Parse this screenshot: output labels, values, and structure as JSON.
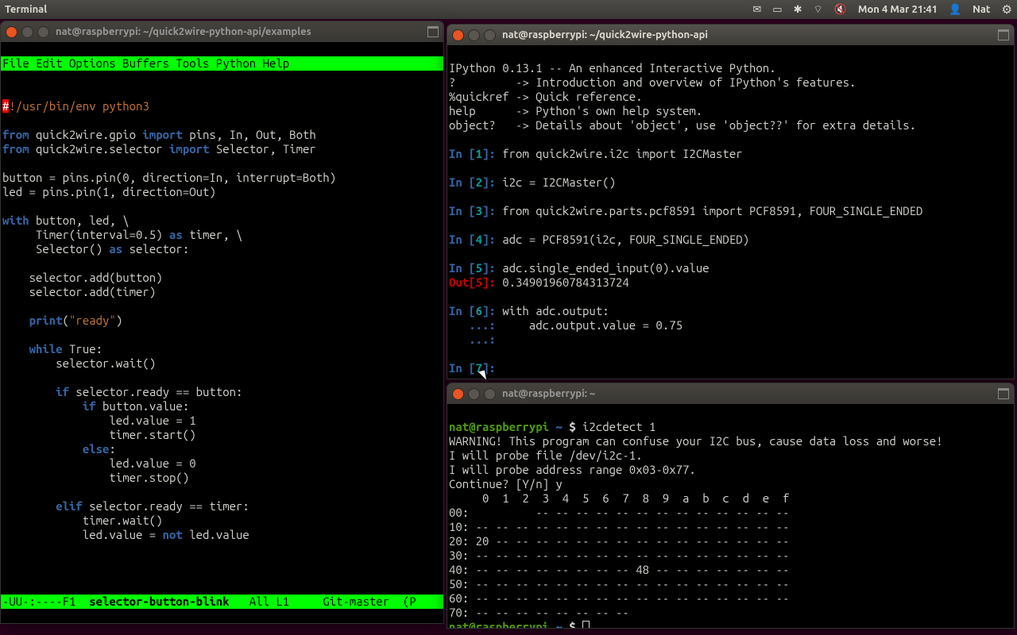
{
  "panel": {
    "app": "Terminal",
    "clock": "Mon  4 Mar 21:41",
    "user": "Nat",
    "mail_icon": "✉",
    "battery_icon": "▭",
    "bt_icon": "✱",
    "wifi_icon": "⌔",
    "sound_icon": "🔇",
    "user_icon": "👤",
    "gear_icon": "⚙"
  },
  "emacs": {
    "title": "nat@raspberrypi: ~/quick2wire-python-api/examples",
    "menus": "File Edit Options Buffers Tools Python Help",
    "shebang_hash": "#",
    "shebang_rest": "!/usr/bin/env python3",
    "code": {
      "l1a": "from",
      "l1b": " quick2wire.gpio ",
      "l1c": "import",
      "l1d": " pins, In, Out, Both",
      "l2a": "from",
      "l2b": " quick2wire.selector ",
      "l2c": "import",
      "l2d": " Selector, Timer",
      "l3": "",
      "l4": "button = pins.pin(0, direction=In, interrupt=Both)",
      "l5": "led = pins.pin(1, direction=Out)",
      "l6": "",
      "l7a": "with",
      "l7b": " button, led, \\",
      "l8a": "     Timer(interval=0.5) ",
      "l8b": "as",
      "l8c": " timer, \\",
      "l9a": "     Selector() ",
      "l9b": "as",
      "l9c": " selector:",
      "l10": "",
      "l11": "    selector.add(button)",
      "l12": "    selector.add(timer)",
      "l13": "",
      "l14a": "    ",
      "l14b": "print",
      "l14c": "(",
      "l14d": "\"ready\"",
      "l14e": ")",
      "l15": "",
      "l16a": "    ",
      "l16b": "while",
      "l16c": " True:",
      "l17": "        selector.wait()",
      "l18": "",
      "l19a": "        ",
      "l19b": "if",
      "l19c": " selector.ready == button:",
      "l20a": "            ",
      "l20b": "if",
      "l20c": " button.value:",
      "l21": "                led.value = 1",
      "l22": "                timer.start()",
      "l23a": "            ",
      "l23b": "else",
      "l23c": ":",
      "l24": "                led.value = 0",
      "l25": "                timer.stop()",
      "l26": "",
      "l27a": "        ",
      "l27b": "elif",
      "l27c": " selector.ready == timer:",
      "l28": "            timer.wait()",
      "l29a": "            led.value = ",
      "l29b": "not",
      "l29c": " led.value"
    },
    "modeline_left": "-UU-:----F1  ",
    "modeline_buf": "selector-button-blink",
    "modeline_right": "   All L1     Git-master  (P"
  },
  "ipython": {
    "title": "nat@raspberrypi: ~/quick2wire-python-api",
    "banner": "IPython 0.13.1 -- An enhanced Interactive Python.\n?         -> Introduction and overview of IPython's features.\n%quickref -> Quick reference.\nhelp      -> Python's own help system.\nobject?   -> Details about 'object', use 'object??' for extra details.",
    "in1": "In [",
    "n1": "1",
    "in1b": "]: ",
    "c1": "from quick2wire.i2c import I2CMaster",
    "n2": "2",
    "c2": "i2c = I2CMaster()",
    "n3": "3",
    "c3": "from quick2wire.parts.pcf8591 import PCF8591, FOUR_SINGLE_ENDED",
    "n4": "4",
    "c4": "adc = PCF8591(i2c, FOUR_SINGLE_ENDED)",
    "n5": "5",
    "c5": "adc.single_ended_input(0).value",
    "out5a": "Out[",
    "out5n": "5",
    "out5b": "]: ",
    "out5v": "0.34901960784313724",
    "n6": "6",
    "c6": "with adc.output:",
    "cont_prefix": "   ...: ",
    "c6b": "    adc.output.value = 0.75",
    "cont_prefix2": "   ...: ",
    "n7": "7"
  },
  "i2c": {
    "title": "nat@raspberrypi: ~",
    "prompt_user": "nat@raspberrypi",
    "prompt_path": " ~ ",
    "prompt_dollar": "$ ",
    "cmd": "i2cdetect 1",
    "warn": "WARNING! This program can confuse your I2C bus, cause data loss and worse!\nI will probe file /dev/i2c-1.\nI will probe address range 0x03-0x77.\nContinue? [Y/n] y",
    "header": "     0  1  2  3  4  5  6  7  8  9  a  b  c  d  e  f",
    "rows": [
      "00:          -- -- -- -- -- -- -- -- -- -- -- -- --",
      "10: -- -- -- -- -- -- -- -- -- -- -- -- -- -- -- --",
      "20: 20 -- -- -- -- -- -- -- -- -- -- -- -- -- -- --",
      "30: -- -- -- -- -- -- -- -- -- -- -- -- -- -- -- --",
      "40: -- -- -- -- -- -- -- -- 48 -- -- -- -- -- -- --",
      "50: -- -- -- -- -- -- -- -- -- -- -- -- -- -- -- --",
      "60: -- -- -- -- -- -- -- -- -- -- -- -- -- -- -- --",
      "70: -- -- -- -- -- -- -- --"
    ]
  }
}
